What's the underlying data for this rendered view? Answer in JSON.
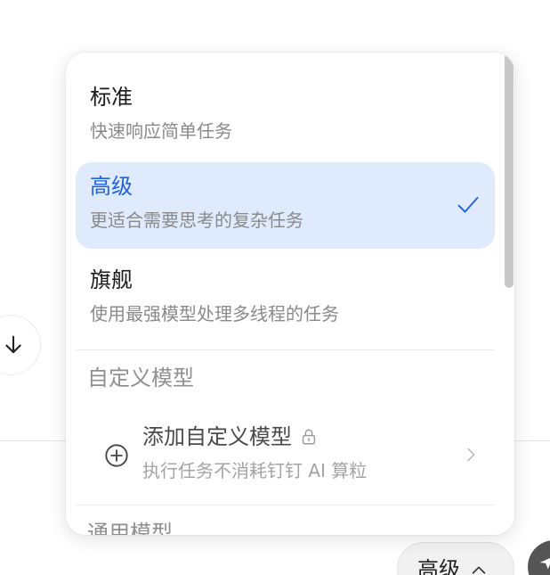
{
  "model_menu": {
    "options": [
      {
        "title": "标准",
        "description": "快速响应简单任务",
        "selected": false
      },
      {
        "title": "高级",
        "description": "更适合需要思考的复杂任务",
        "selected": true
      },
      {
        "title": "旗舰",
        "description": "使用最强模型处理多线程的任务",
        "selected": false
      }
    ],
    "custom_section": {
      "heading": "自定义模型",
      "add_item": {
        "title": "添加自定义模型",
        "description": "执行任务不消耗钉钉 AI 算粒"
      }
    },
    "general_section": {
      "heading": "通用模型"
    }
  },
  "composer": {
    "model_select_label": "高级"
  },
  "colors": {
    "accent": "#1f63e0",
    "selected_bg": "#dfeafd"
  }
}
